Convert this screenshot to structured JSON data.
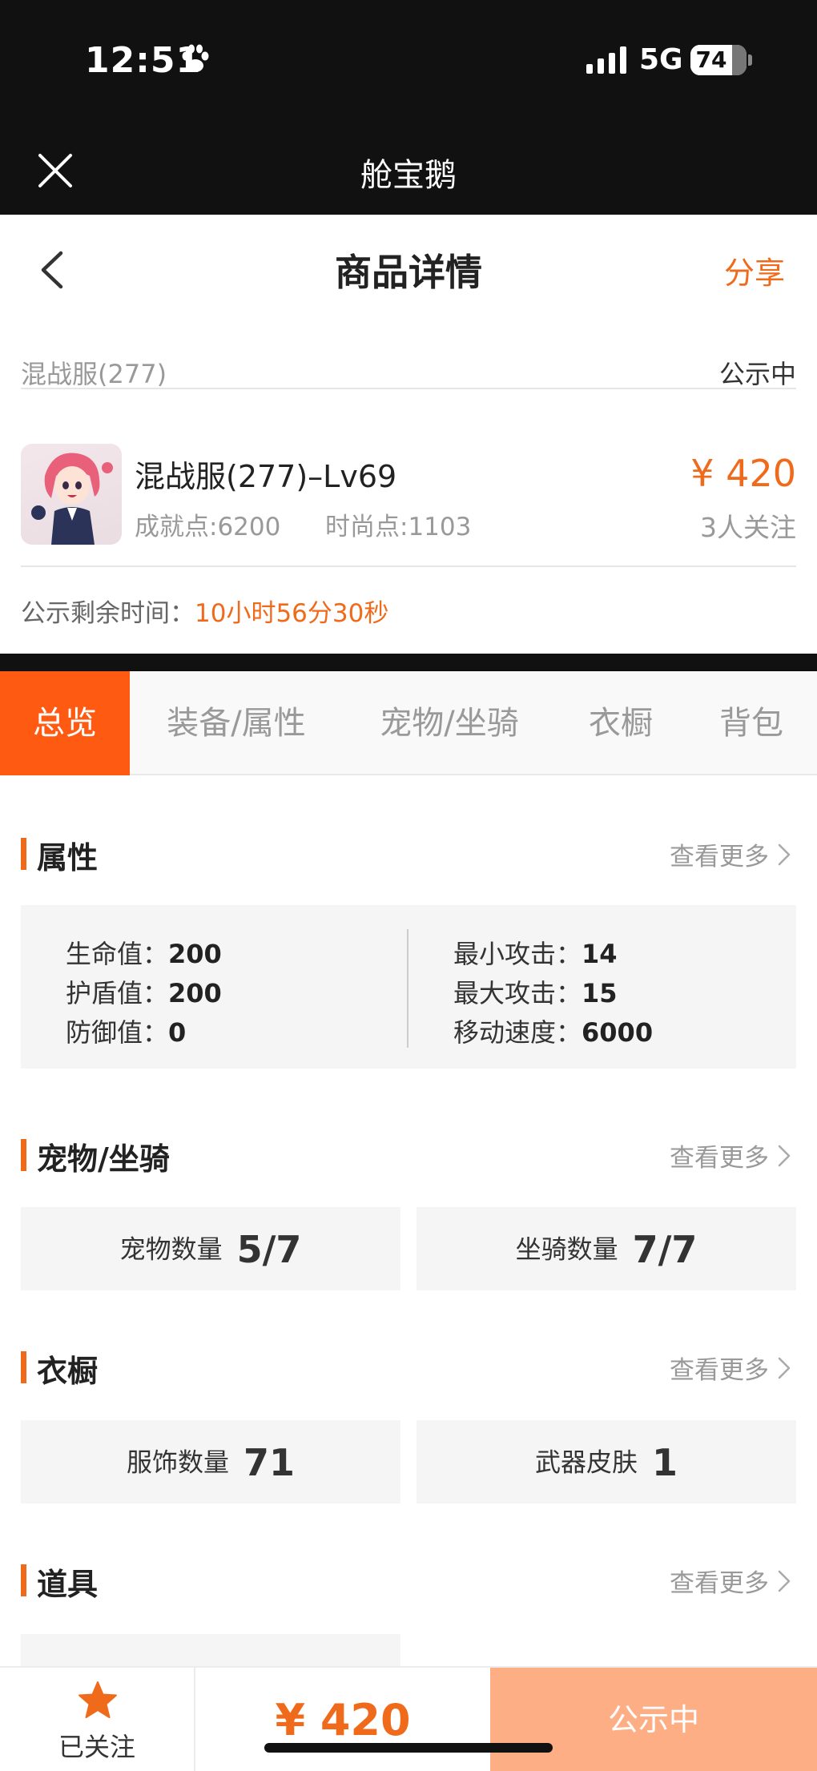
{
  "status_bar": {
    "time": "12:51",
    "network": "5G",
    "battery": "74"
  },
  "app_header": {
    "title": "舱宝鹅"
  },
  "nav": {
    "title": "商品详情",
    "share": "分享"
  },
  "server": {
    "name": "混战服(277)",
    "status": "公示中"
  },
  "product": {
    "name": "混战服(277)–Lv69",
    "achievement": "成就点:6200",
    "fashion": "时尚点:1103",
    "price": "¥ 420",
    "followers": "3人关注"
  },
  "countdown": {
    "label": "公示剩余时间：",
    "value": "10小时56分30秒"
  },
  "tabs": [
    "总览",
    "装备/属性",
    "宠物/坐骑",
    "衣橱",
    "背包"
  ],
  "sections": {
    "attributes": {
      "title": "属性",
      "more": "查看更多",
      "left": [
        {
          "label": "生命值：",
          "value": "200"
        },
        {
          "label": "护盾值：",
          "value": "200"
        },
        {
          "label": "防御值：",
          "value": "0"
        }
      ],
      "right": [
        {
          "label": "最小攻击：",
          "value": "14"
        },
        {
          "label": "最大攻击：",
          "value": "15"
        },
        {
          "label": "移动速度：",
          "value": "6000"
        }
      ]
    },
    "pets": {
      "title": "宠物/坐骑",
      "more": "查看更多",
      "cards": [
        {
          "label": "宠物数量",
          "value": "5/7"
        },
        {
          "label": "坐骑数量",
          "value": "7/7"
        }
      ]
    },
    "wardrobe": {
      "title": "衣橱",
      "more": "查看更多",
      "cards": [
        {
          "label": "服饰数量",
          "value": "71"
        },
        {
          "label": "武器皮肤",
          "value": "1"
        }
      ]
    },
    "items": {
      "title": "道具",
      "more": "查看更多"
    }
  },
  "bottom_bar": {
    "follow": "已关注",
    "price": "¥ 420",
    "button": "公示中"
  },
  "colors": {
    "accent": "#f06a1c",
    "tab_active": "#ff5a12",
    "button": "#fdae84"
  },
  "icons": [
    "paw-icon",
    "signal-icon",
    "battery-icon",
    "close-icon",
    "back-arrow-icon",
    "chevron-right-icon",
    "star-icon"
  ]
}
